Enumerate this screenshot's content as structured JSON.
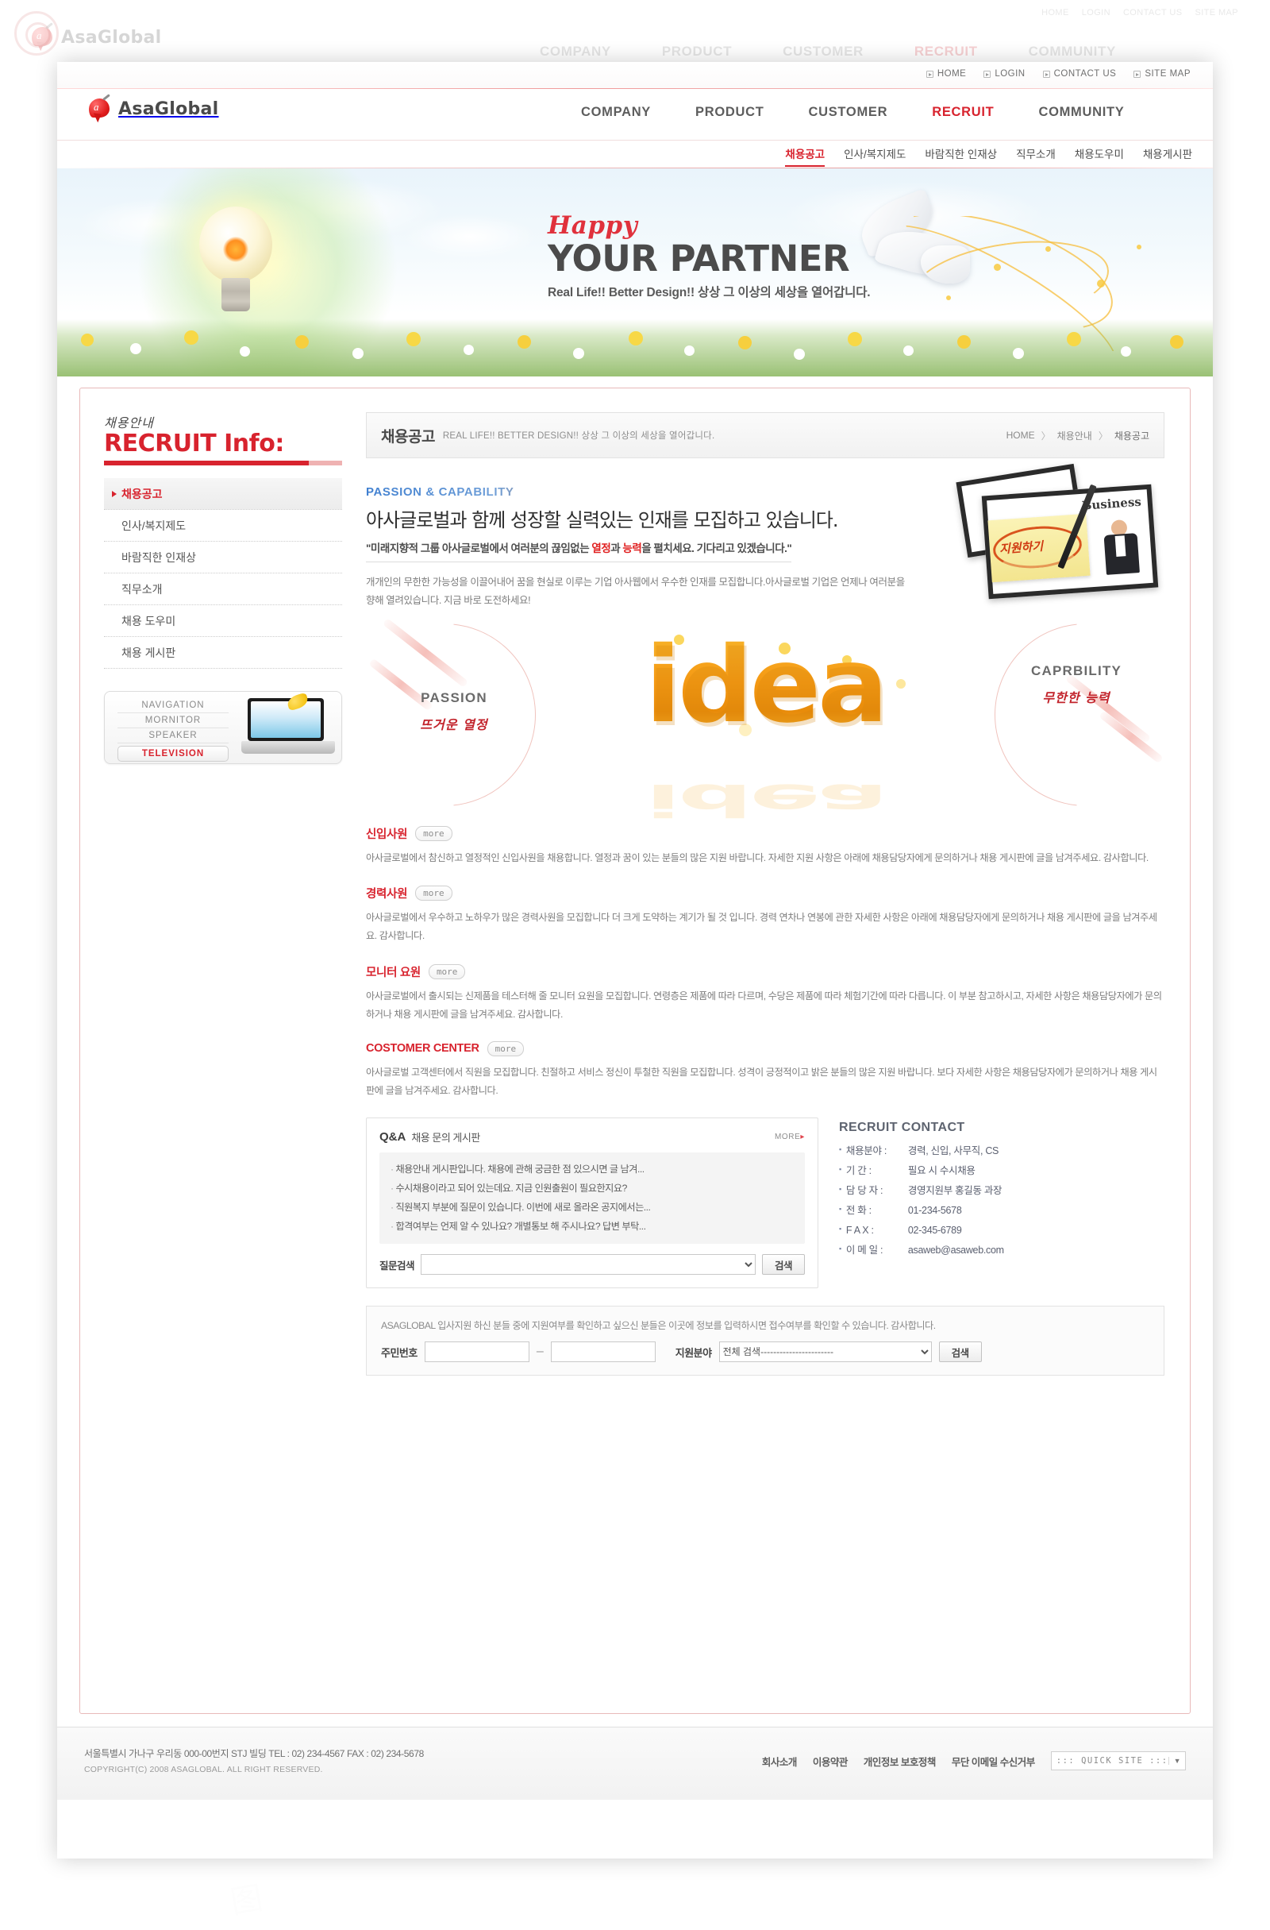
{
  "site": {
    "brand": "AsaGlobal"
  },
  "utility": {
    "links": [
      {
        "label": "HOME"
      },
      {
        "label": "LOGIN"
      },
      {
        "label": "CONTACT US"
      },
      {
        "label": "SITE MAP"
      }
    ]
  },
  "gnb": [
    {
      "label": "COMPANY",
      "active": false
    },
    {
      "label": "PRODUCT",
      "active": false
    },
    {
      "label": "CUSTOMER",
      "active": false
    },
    {
      "label": "RECRUIT",
      "active": true
    },
    {
      "label": "COMMUNITY",
      "active": false
    }
  ],
  "subnav": [
    {
      "label": "채용공고",
      "active": true
    },
    {
      "label": "인사/복지제도",
      "active": false
    },
    {
      "label": "바람직한 인재상",
      "active": false
    },
    {
      "label": "직무소개",
      "active": false
    },
    {
      "label": "채용도우미",
      "active": false
    },
    {
      "label": "채용게시판",
      "active": false
    }
  ],
  "hero": {
    "happy": "Happy",
    "headline": "YOUR PARTNER",
    "subline": "Real Life!! Better Design!! 상상 그 이상의 세상을 열어갑니다."
  },
  "sidebar": {
    "hand_title": "채용안내",
    "title": "RECRUIT Info:",
    "items": [
      {
        "label": "채용공고",
        "active": true
      },
      {
        "label": "인사/복지제도",
        "active": false
      },
      {
        "label": "바람직한 인재상",
        "active": false
      },
      {
        "label": "직무소개",
        "active": false
      },
      {
        "label": "채용 도우미",
        "active": false
      },
      {
        "label": "채용 게시판",
        "active": false
      }
    ],
    "widget": {
      "rows": [
        "NAVIGATION",
        "MORNITOR",
        "SPEAKER"
      ],
      "selected": "TELEVISION"
    }
  },
  "pagetitle": {
    "kr": "채용공고",
    "en": "REAL LIFE!! BETTER DESIGN!! 상상 그 이상의 세상을 열어갑니다.",
    "breadcrumb": [
      "HOME",
      "채용안내",
      "채용공고"
    ],
    "separator": "〉"
  },
  "intro": {
    "eyebrow": "PASSION & CAPABILITY",
    "headline": "아사글로벌과 함께 성장할 실력있는 인재를 모집하고 있습니다.",
    "quote_pre": "\"미래지향적 그룹 아사글로벌에서 여러분의 끊임없는 ",
    "quote_em1": "열정",
    "quote_mid": "과 ",
    "quote_em2": "능력",
    "quote_post": "을 펼치세요. 기다리고 있겠습니다.\"",
    "description": "개개인의 무한한 가능성을 이끌어내어 꿈을 현실로 이루는 기업 아사웹에서 우수한  인재를 모집합니다.아사글로벌 기업은 언제나 여러분을 향해 열려있습니다.  지금 바로 도전하세요!",
    "card": {
      "business_label": "Business",
      "sticky_text": "지원하기"
    }
  },
  "idea": {
    "word": "idea",
    "left_en": "PASSION",
    "left_kr": "뜨거운 열정",
    "right_en": "CAPRBILITY",
    "right_kr": "무한한 능력"
  },
  "jobs": [
    {
      "name": "신입사원",
      "more": "more",
      "body": "아사글로벌에서 참신하고 열정적인  신입사원을 채용합니다. 열정과 꿈이 있는 분들의 많은 지원 바랍니다. 자세한 지원 사항은 아래에 채용담당자에게 문의하거나 채용 게시판에 글을 남겨주세요. 감사합니다."
    },
    {
      "name": "경력사원",
      "more": "more",
      "body": "아사글로벌에서 우수하고 노하우가 많은 경력사원을 모집합니다  더 크게 도약하는 계기가 될 것 입니다. 경력 연차나 연봉에 관한 자세한 사항은 아래에 채용담당자에게 문의하거나 채용 게시판에 글을 남겨주세요. 감사합니다."
    },
    {
      "name": "모니터 요원",
      "more": "more",
      "body": "아사글로벌에서 출시되는 신제품을 테스터해 줄 모니터 요원을 모집합니다. 연령층은 제품에 따라 다르며, 수당은 제품에 따라 체험기간에 따라 다릅니다. 이 부분 참고하시고, 자세한 사항은 채용담당자에가 문의하거나 채용 게시판에 글을 남겨주세요. 감사합니다."
    },
    {
      "name": "COSTOMER CENTER",
      "more": "more",
      "body": "아사글로벌 고객센터에서 직원을 모집합니다. 친절하고 서비스 정신이 투철한 직원을 모집합니다. 성격이 긍정적이고 밝은 분들의 많은 지원 바랍니다.  보다 자세한 사항은 채용담당자에가 문의하거나 채용 게시판에 글을 남겨주세요. 감사합니다."
    }
  ],
  "qna": {
    "title": "Q&A",
    "subtitle": "채용 문의 게시판",
    "more": "MORE",
    "items": [
      "채용안내 게시판입니다. 채용에 관해 궁금한 점 있으시면 글 남겨...",
      "수시채용이라고 되어 있는데요. 지금 인원출원이 필요한지요?",
      "직원복지 부분에 질문이 있습니다. 이번에 새로 올라온 공지에서는...",
      "합격여부는 언제 알 수 있나요? 개별통보 해 주시나요? 답변 부탁..."
    ],
    "search_label": "질문검색",
    "search_value": "",
    "search_button": "검색"
  },
  "contact": {
    "title": "RECRUIT CONTACT",
    "rows": [
      {
        "key": "채용분야 :",
        "value": "경력, 신입, 사무직, CS"
      },
      {
        "key": "기     간 :",
        "value": "필요 시 수시채용"
      },
      {
        "key": "담 당 자 :",
        "value": "경영지원부 홍길동 과장"
      },
      {
        "key": "전     화 :",
        "value": "01-234-5678"
      },
      {
        "key": "F  A  X :",
        "value": "02-345-6789"
      },
      {
        "key": "이 메 일 :",
        "value": "asaweb@asaweb.com"
      }
    ]
  },
  "apply": {
    "note": "ASAGLOBAL 입사지원 하신 분들 중에 지원여부를 확인하고 싶으신 분들은 이곳에 정보를 입력하시면 접수여부를 확인할 수 있습니다. 감사합니다.",
    "id_label": "주민번호",
    "id_front": "",
    "id_back": "",
    "field_label": "지원분야",
    "field_selected": "전체 검색-----------------------",
    "search_button": "검색"
  },
  "footer": {
    "address": "서울특별시 가나구 우리동 000-00번지 STJ 빌딩  TEL : 02) 234-4567  FAX : 02) 234-5678",
    "copyright": "COPYRIGHT(C) 2008 ASAGLOBAL. ALL RIGHT RESERVED.",
    "links": [
      "회사소개",
      "이용약관",
      "개인정보 보호정책",
      "무단 이메일 수신거부"
    ],
    "quick_label": "::: QUICK SITE :::"
  },
  "colors": {
    "accent_red": "#d8232e",
    "idea_orange": "#f5a623",
    "text_gray": "#7e7e7e"
  }
}
